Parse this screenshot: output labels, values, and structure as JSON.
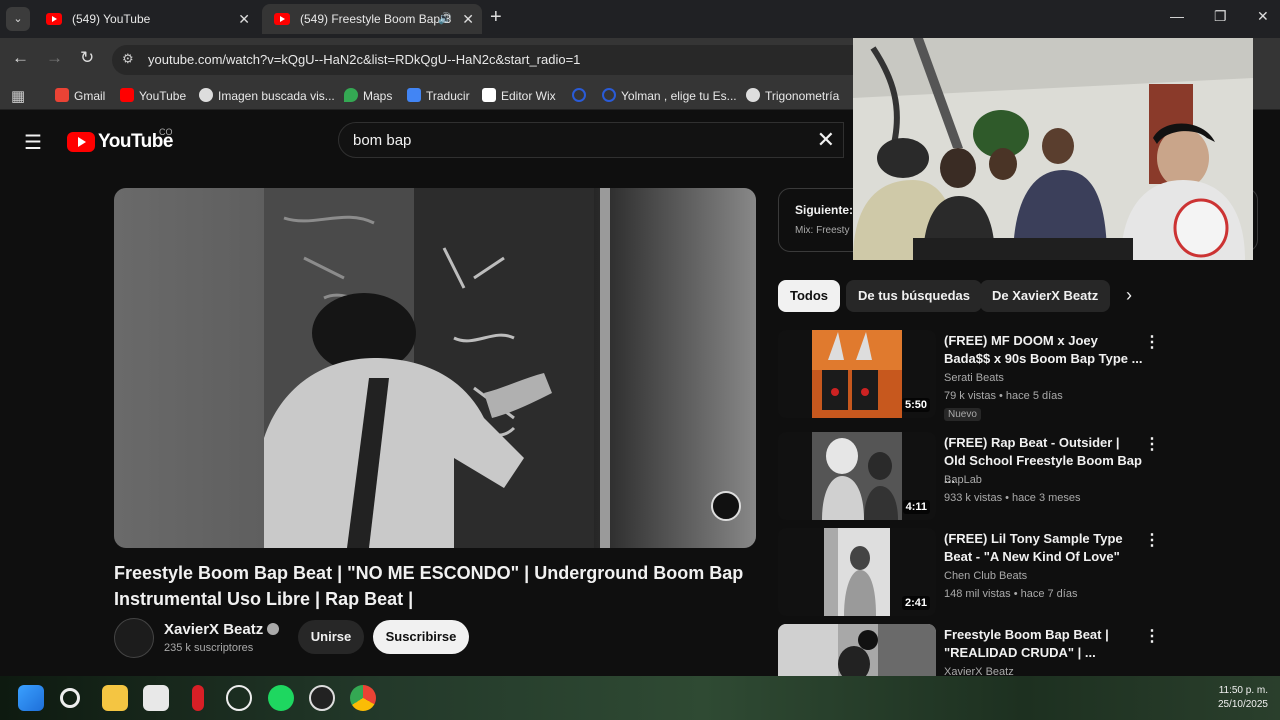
{
  "browser": {
    "tabs": [
      {
        "label": "(549) YouTube"
      },
      {
        "label": "(549) Freestyle Boom Bap B"
      }
    ],
    "new_tab": "+",
    "url": "youtube.com/watch?v=kQgU--HaN2c&list=RDkQgU--HaN2c&start_radio=1",
    "bookmarks": [
      {
        "label": "Gmail",
        "color": "#ea4335"
      },
      {
        "label": "YouTube",
        "color": "#ff0000"
      },
      {
        "label": "Imagen buscada vis...",
        "color": "#dddddd"
      },
      {
        "label": "Maps",
        "color": "#34a853"
      },
      {
        "label": "Traducir",
        "color": "#4285f4"
      },
      {
        "label": "Editor Wix",
        "color": "#ffffff"
      },
      {
        "label": "",
        "color": "#2a5bd7"
      },
      {
        "label": "Yolman , elige tu Es...",
        "color": "#2a5bd7"
      },
      {
        "label": "Trigonometría",
        "color": "#dddddd"
      }
    ]
  },
  "header": {
    "logo_text": "YouTube",
    "country_code": "CO",
    "search_query": "bom bap"
  },
  "video": {
    "title": "Freestyle Boom Bap Beat | \"NO ME ESCONDO\" | Underground Boom Bap Instrumental Uso Libre | Rap Beat |",
    "channel": "XavierX Beatz",
    "subscribers": "235 k suscriptores",
    "join_label": "Unirse",
    "subscribe_label": "Suscribirse"
  },
  "queue": {
    "label": "Siguiente:",
    "subtitle": "Mix: Freesty"
  },
  "chips": [
    "Todos",
    "De tus búsquedas",
    "De XavierX Beatz"
  ],
  "recommendations": [
    {
      "title": "(FREE) MF DOOM x Joey Bada$$ x 90s Boom Bap Type ...",
      "channel": "Serati Beats",
      "meta": "79 k vistas • hace 5 días",
      "duration": "5:50",
      "badge": "Nuevo"
    },
    {
      "title": "(FREE) Rap Beat - Outsider | Old School Freestyle Boom Bap ...",
      "channel": "BapLab",
      "meta": "933 k vistas • hace 3 meses",
      "duration": "4:11",
      "badge": ""
    },
    {
      "title": "(FREE) Lil Tony Sample Type Beat - \"A New Kind Of Love\"",
      "channel": "Chen Club Beats",
      "meta": "148 mil vistas • hace 7 días",
      "duration": "2:41",
      "badge": ""
    },
    {
      "title": "Freestyle Boom Bap Beat | \"REALIDAD CRUDA\" | ...",
      "channel": "XavierX Beatz",
      "meta": "",
      "duration": "",
      "badge": ""
    }
  ],
  "taskbar": {
    "time": "11:50 p. m.",
    "date": "25/10/2025"
  }
}
